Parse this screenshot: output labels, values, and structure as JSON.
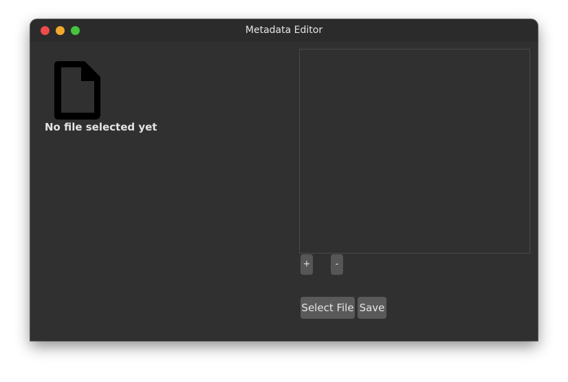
{
  "window": {
    "title": "Metadata Editor"
  },
  "file_preview": {
    "icon": "document-icon",
    "status_text": "No file selected yet"
  },
  "metadata_list": {
    "add_label": "+",
    "remove_label": "-"
  },
  "actions": {
    "select_file_label": "Select File",
    "save_label": "Save"
  },
  "colors": {
    "window_bg": "#303030",
    "titlebar_bg": "#2b2b2b",
    "button_bg": "#5a5a5a",
    "close": "#ef4b4b",
    "minimize": "#f0a92b",
    "maximize": "#45c43d"
  }
}
